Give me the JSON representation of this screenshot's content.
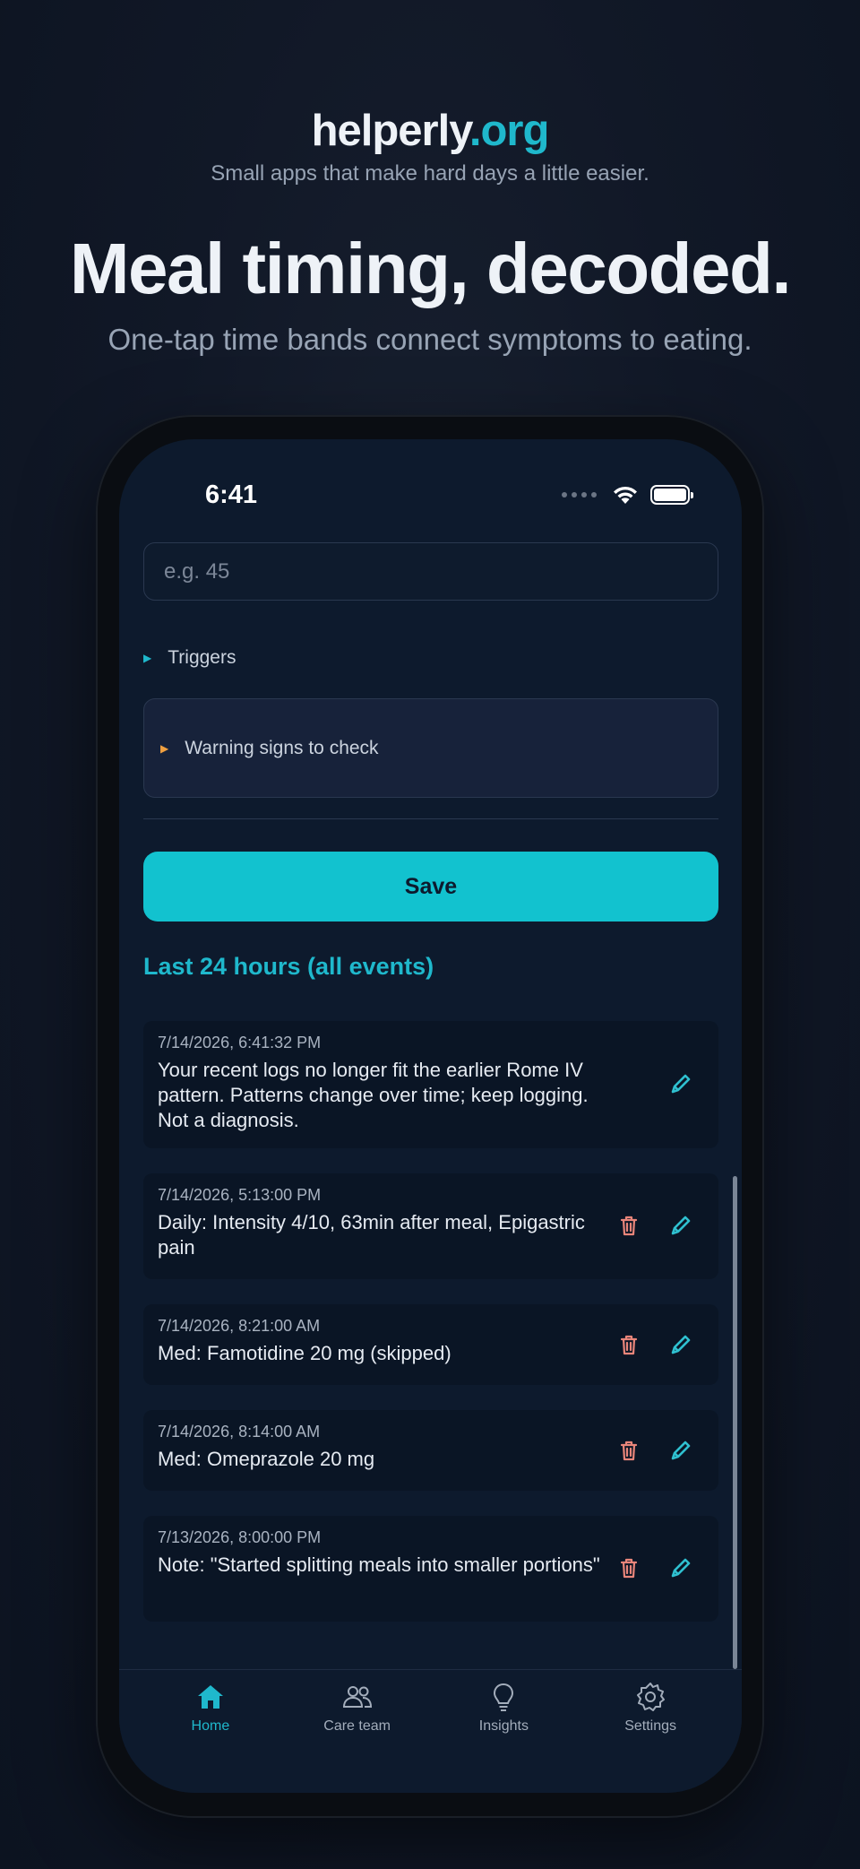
{
  "brand": {
    "name": "helperly",
    "tld": ".org",
    "tagline": "Small apps that make hard days a little easier."
  },
  "hero": {
    "headline": "Meal timing, decoded.",
    "subhead": "One-tap time bands connect symptoms to eating."
  },
  "status_bar": {
    "time": "6:41"
  },
  "form": {
    "duration_placeholder": "e.g. 45",
    "triggers_label": "Triggers",
    "warning_label": "Warning signs to check",
    "save_label": "Save"
  },
  "events_section": {
    "title": "Last 24 hours (all events)",
    "items": [
      {
        "timestamp": "7/14/2026, 6:41:32 PM",
        "text": "Your recent logs no longer fit the earlier Rome IV pattern. Patterns change over time; keep logging. Not a diagnosis.",
        "deletable": false
      },
      {
        "timestamp": "7/14/2026, 5:13:00 PM",
        "text": "Daily: Intensity 4/10, 63min after meal, Epigastric pain",
        "deletable": true
      },
      {
        "timestamp": "7/14/2026, 8:21:00 AM",
        "text": "Med: Famotidine 20 mg (skipped)",
        "deletable": true
      },
      {
        "timestamp": "7/14/2026, 8:14:00 AM",
        "text": "Med: Omeprazole 20 mg",
        "deletable": true
      },
      {
        "timestamp": "7/13/2026, 8:00:00 PM",
        "text": "Note: \"Started splitting meals into smaller portions\"",
        "deletable": true
      }
    ]
  },
  "tabbar": {
    "tabs": [
      {
        "label": "Home",
        "icon": "home-icon",
        "active": true
      },
      {
        "label": "Care team",
        "icon": "people-icon",
        "active": false
      },
      {
        "label": "Insights",
        "icon": "lightbulb-icon",
        "active": false
      },
      {
        "label": "Settings",
        "icon": "gear-icon",
        "active": false
      }
    ]
  },
  "colors": {
    "accent": "#12c2cf",
    "background": "#0d1a2d",
    "delete": "#e8857a"
  }
}
